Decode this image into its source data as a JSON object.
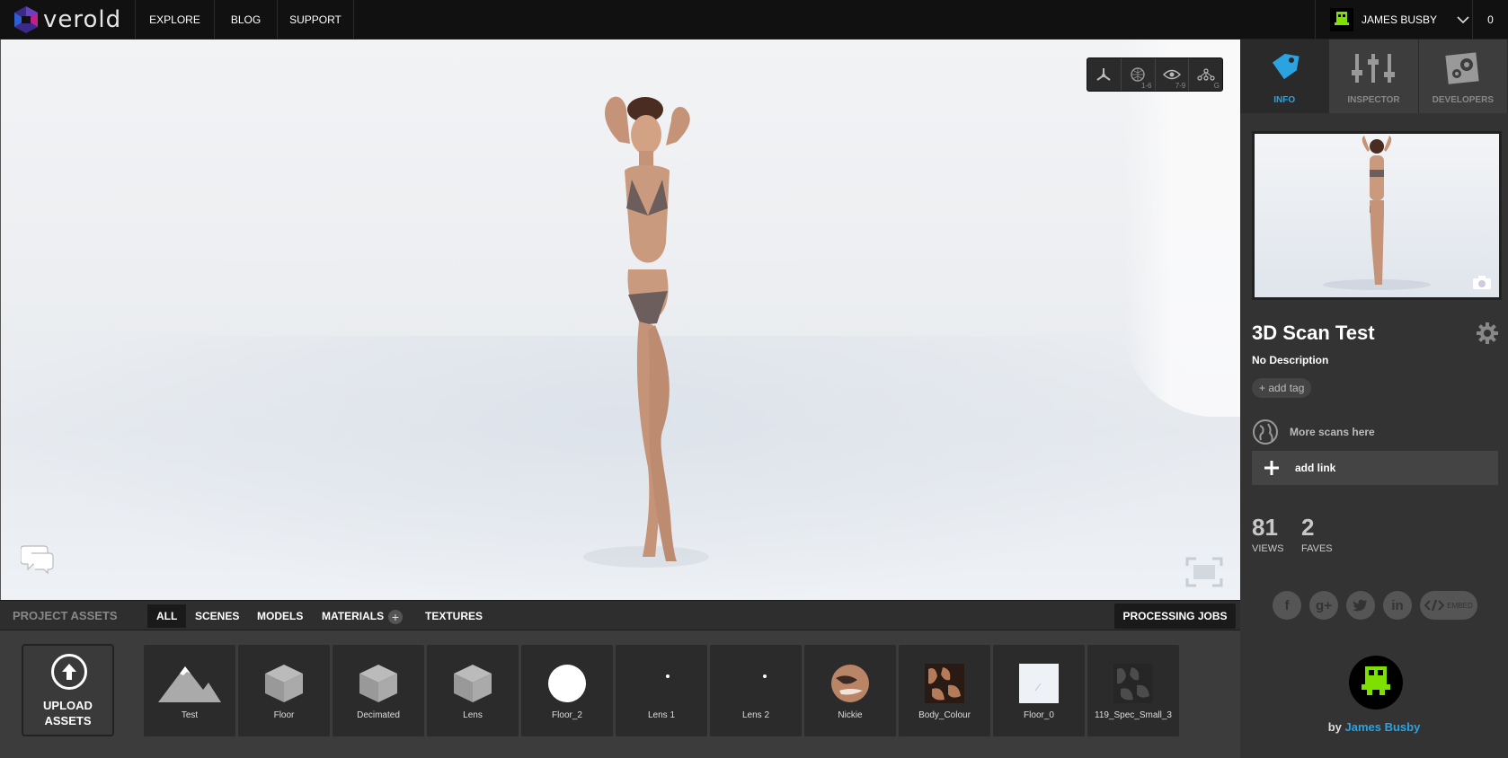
{
  "brand": {
    "name": "verold"
  },
  "nav": {
    "items": [
      "EXPLORE",
      "BLOG",
      "SUPPORT"
    ]
  },
  "user": {
    "name": "JAMES BUSBY",
    "notifications": "0"
  },
  "viewer": {
    "toolbar": [
      {
        "icon": "axes-icon",
        "key": ""
      },
      {
        "icon": "sphere-icon",
        "key": "1-6"
      },
      {
        "icon": "eye-icon",
        "key": "7-9"
      },
      {
        "icon": "graph-icon",
        "key": "G"
      }
    ]
  },
  "assets": {
    "title": "PROJECT ASSETS",
    "tabs": [
      "ALL",
      "SCENES",
      "MODELS",
      "MATERIALS",
      "TEXTURES"
    ],
    "active_tab": "ALL",
    "processing_jobs": "PROCESSING JOBS",
    "upload_label_1": "UPLOAD",
    "upload_label_2": "ASSETS",
    "items": [
      {
        "label": "Test",
        "icon": "mountain-icon"
      },
      {
        "label": "Floor",
        "icon": "cube-icon"
      },
      {
        "label": "Decimated",
        "icon": "cube-icon"
      },
      {
        "label": "Lens",
        "icon": "cube-icon"
      },
      {
        "label": "Floor_2",
        "icon": "white-sphere-icon"
      },
      {
        "label": "Lens 1",
        "icon": "dot-icon"
      },
      {
        "label": "Lens 2",
        "icon": "dot-icon"
      },
      {
        "label": "Nickie",
        "icon": "skin-sphere-icon"
      },
      {
        "label": "Body_Colour",
        "icon": "texture-thumb"
      },
      {
        "label": "Floor_0",
        "icon": "texture-thumb"
      },
      {
        "label": "119_Spec_Small_3",
        "icon": "texture-thumb"
      }
    ]
  },
  "panel": {
    "tabs": [
      "INFO",
      "INSPECTOR",
      "DEVELOPERS"
    ],
    "active_tab": "INFO",
    "title": "3D Scan Test",
    "description": "No Description",
    "add_tag": "+ add tag",
    "link": "More scans here",
    "add_link": "add link",
    "views_count": "81",
    "views_label": "VIEWS",
    "faves_count": "2",
    "faves_label": "FAVES",
    "embed_label": "EMBED",
    "by_prefix": "by",
    "author": "James Busby",
    "accent": "#2aa3e0"
  }
}
